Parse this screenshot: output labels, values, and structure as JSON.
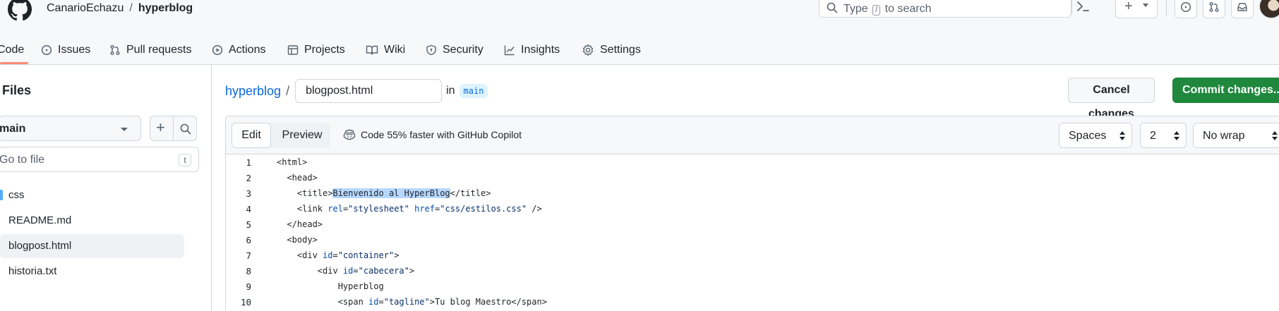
{
  "header": {
    "owner": "CanarioEchazu",
    "separator": "/",
    "repo": "hyperblog",
    "search_prefix": "Type",
    "search_key": "/",
    "search_suffix": "to search"
  },
  "tabs": [
    {
      "label": "Code",
      "icon": "code-icon"
    },
    {
      "label": "Issues",
      "icon": "issue-opened-icon"
    },
    {
      "label": "Pull requests",
      "icon": "git-pull-request-icon"
    },
    {
      "label": "Actions",
      "icon": "play-icon"
    },
    {
      "label": "Projects",
      "icon": "table-icon"
    },
    {
      "label": "Wiki",
      "icon": "book-icon"
    },
    {
      "label": "Security",
      "icon": "shield-icon"
    },
    {
      "label": "Insights",
      "icon": "graph-icon"
    },
    {
      "label": "Settings",
      "icon": "gear-icon"
    }
  ],
  "sidebar": {
    "title": "Files",
    "branch": "main",
    "goto_placeholder": "Go to file",
    "goto_key": "t",
    "items": [
      {
        "label": "css",
        "type": "folder"
      },
      {
        "label": "README.md",
        "type": "file"
      },
      {
        "label": "blogpost.html",
        "type": "file",
        "selected": true
      },
      {
        "label": "historia.txt",
        "type": "file"
      }
    ]
  },
  "editor": {
    "breadcrumb_repo": "hyperblog",
    "breadcrumb_sep": "/",
    "filename": "blogpost.html",
    "in_label": "in",
    "branch": "main",
    "cancel_label": "Cancel changes",
    "commit_label": "Commit changes...",
    "edit_tab": "Edit",
    "preview_tab": "Preview",
    "copilot_text": "Code 55% faster with GitHub Copilot",
    "indent_mode": "Spaces",
    "indent_size": "2",
    "wrap_mode": "No wrap"
  },
  "code": {
    "lines": [
      {
        "n": "1",
        "text": "<html>"
      },
      {
        "n": "2",
        "text": "  <head>"
      },
      {
        "n": "3",
        "text": "    <title>Bienvenido al HyperBlog</title>"
      },
      {
        "n": "4",
        "text": "    <link rel=\"stylesheet\" href=\"css/estilos.css\" />"
      },
      {
        "n": "5",
        "text": "  </head>"
      },
      {
        "n": "6",
        "text": "  <body>"
      },
      {
        "n": "7",
        "text": "    <div id=\"container\">"
      },
      {
        "n": "8",
        "text": "        <div id=\"cabecera\">"
      },
      {
        "n": "9",
        "text": "            Hyperblog"
      },
      {
        "n": "10",
        "text": "            <span id=\"tagline\">Tu blog Maestro</span>"
      }
    ]
  },
  "colors": {
    "accent_blue": "#0969da",
    "commit_green": "#1f883d",
    "active_tab_underline": "#fd8c73",
    "selection": "#b6d7ff"
  }
}
